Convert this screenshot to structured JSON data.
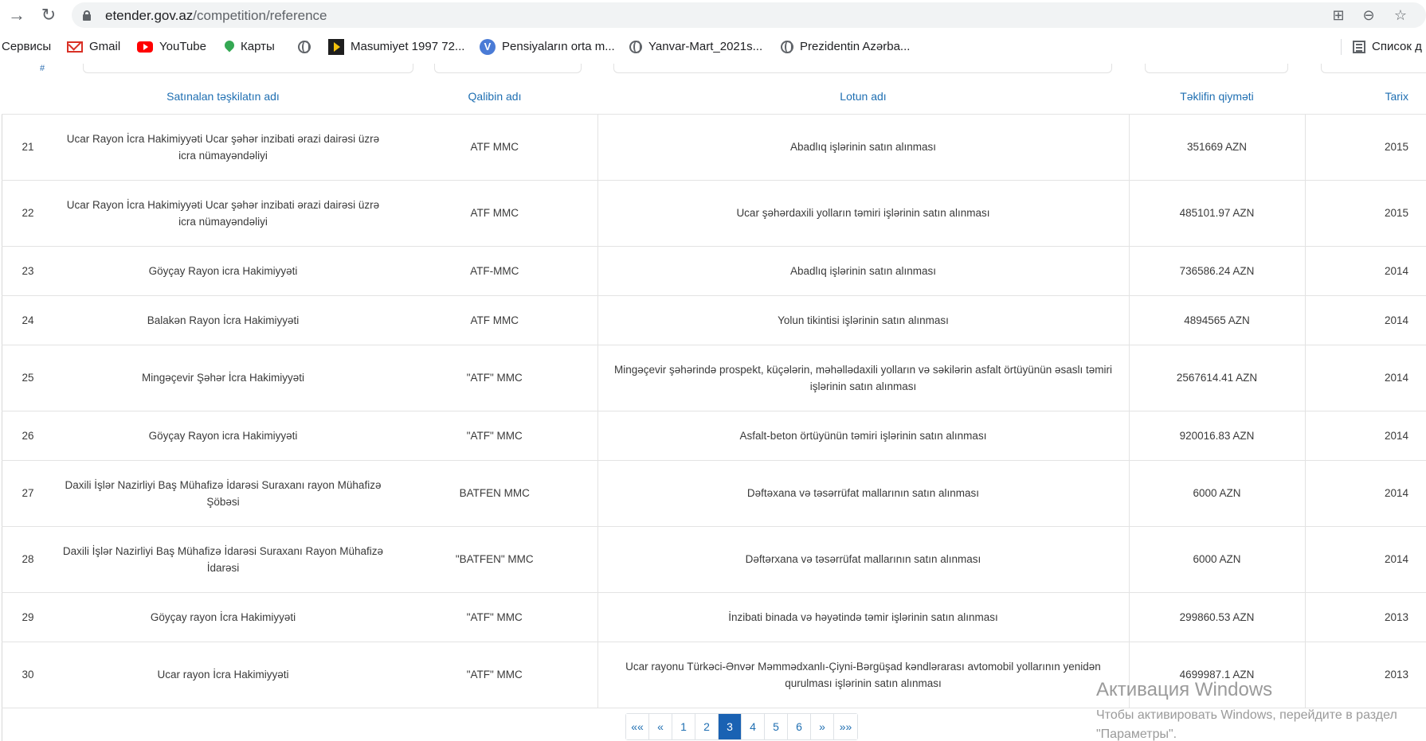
{
  "browser": {
    "url_domain": "etender.gov.az",
    "url_path": "/competition/reference",
    "bookmarks": {
      "services": "Сервисы",
      "gmail": "Gmail",
      "youtube": "YouTube",
      "maps": "Карты",
      "masumiyet": "Masumiyet 1997 72...",
      "pensiya": "Pensiyaların orta m...",
      "yanvar": "Yanvar-Mart_2021s...",
      "prezident": "Prezidentin Azərba...",
      "reading_list": "Список д"
    },
    "icons": [
      "back-arrow-icon",
      "reload-icon",
      "lock-icon",
      "translate-icon",
      "zoom-icon",
      "star-icon"
    ]
  },
  "table": {
    "filter_hash": "#",
    "headers": {
      "org": "Satınalan təşkilatın adı",
      "winner": "Qalibin adı",
      "lot": "Lotun adı",
      "price": "Təklifin qiyməti",
      "date": "Tarix"
    },
    "rows": [
      {
        "num": "21",
        "org": "Ucar Rayon İcra Hakimiyyəti Ucar şəhər inzibati ərazi dairəsi üzrə icra nümayəndəliyi",
        "winner": "ATF MMC",
        "lot": "Abadlıq işlərinin satın alınması",
        "price": "351669 AZN",
        "date": "2015"
      },
      {
        "num": "22",
        "org": "Ucar Rayon İcra Hakimiyyəti Ucar şəhər inzibati ərazi dairəsi üzrə icra nümayəndəliyi",
        "winner": "ATF MMC",
        "lot": "Ucar şəhərdaxili yolların təmiri işlərinin satın alınması",
        "price": "485101.97 AZN",
        "date": "2015"
      },
      {
        "num": "23",
        "org": "Göyçay Rayon icra Hakimiyyəti",
        "winner": "ATF-MMC",
        "lot": "Abadlıq işlərinin satın alınması",
        "price": "736586.24 AZN",
        "date": "2014"
      },
      {
        "num": "24",
        "org": "Balakən Rayon İcra Hakimiyyəti",
        "winner": "ATF MMC",
        "lot": "Yolun tikintisi işlərinin satın alınması",
        "price": "4894565 AZN",
        "date": "2014"
      },
      {
        "num": "25",
        "org": "Mingəçevir Şəhər İcra Hakimiyyəti",
        "winner": "\"ATF\" MMC",
        "lot": "Mingəçevir şəhərində prospekt, küçələrin, məhəllədaxili yolların və səkilərin asfalt örtüyünün əsaslı təmiri işlərinin satın alınması",
        "price": "2567614.41 AZN",
        "date": "2014"
      },
      {
        "num": "26",
        "org": "Göyçay Rayon icra Hakimiyyəti",
        "winner": "\"ATF\" MMC",
        "lot": "Asfalt-beton örtüyünün təmiri işlərinin satın alınması",
        "price": "920016.83 AZN",
        "date": "2014"
      },
      {
        "num": "27",
        "org": "Daxili İşlər Nazirliyi Baş Mühafizə İdarəsi Suraxanı rayon Mühafizə Şöbəsi",
        "winner": "BATFEN MMC",
        "lot": "Dəftəxana və təsərrüfat mallarının satın alınması",
        "price": "6000 AZN",
        "date": "2014"
      },
      {
        "num": "28",
        "org": "Daxili İşlər Nazirliyi Baş Mühafizə İdarəsi Suraxanı Rayon Mühafizə İdarəsi",
        "winner": "\"BATFEN\" MMC",
        "lot": "Dəftərxana və təsərrüfat mallarının satın alınması",
        "price": "6000 AZN",
        "date": "2014"
      },
      {
        "num": "29",
        "org": "Göyçay rayon İcra Hakimiyyəti",
        "winner": "\"ATF\" MMC",
        "lot": "İnzibati binada və həyətində təmir işlərinin satın alınması",
        "price": "299860.53 AZN",
        "date": "2013"
      },
      {
        "num": "30",
        "org": "Ucar rayon İcra Hakimiyyəti",
        "winner": "\"ATF\" MMC",
        "lot": "Ucar rayonu Türkəci-Ənvər Məmmədxanlı-Çiyni-Bərgüşad kəndlərarası avtomobil yollarının yenidən qurulması işlərinin satın alınması",
        "price": "4699987.1 AZN",
        "date": "2013"
      }
    ]
  },
  "pagination": {
    "first": "««",
    "prev": "«",
    "pages": [
      "1",
      "2",
      "3",
      "4",
      "5",
      "6"
    ],
    "current": "3",
    "next": "»",
    "last": "»»"
  },
  "watermark": {
    "title": "Активация Windows",
    "line1": "Чтобы активировать Windows, перейдите в раздел",
    "line2": "\"Параметры\"."
  }
}
